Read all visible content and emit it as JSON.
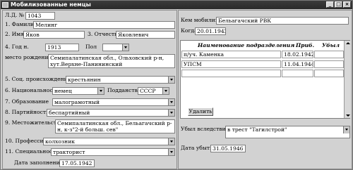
{
  "window": {
    "title": "Мобилизованные немцы"
  },
  "left": {
    "ld_label": "Л.Д. №",
    "ld_value": "1043",
    "surname_label": "1. Фамилия",
    "surname_value": "Мелинг",
    "name_label": "2. Имя",
    "name_value": "Яков",
    "patronymic_label": "3. Отчество",
    "patronymic_value": "Яковлевич",
    "birthyear_label": "4. Год н.",
    "birthyear_value": "1913",
    "sex_label": "Пол",
    "sex_value": "",
    "birthplace_label": "место рождения",
    "birthplace_value": "Семипалатинская обл., Ольховский р-н, хут.Верхне-Панининский",
    "social_label": "5. Соц. происхождение",
    "social_value": "крестьянин",
    "nationality_label": "6. Национальность",
    "nationality_value": "немец",
    "citizenship_label": "Подданство",
    "citizenship_value": "СССР",
    "education_label": "7. Образование",
    "education_value": "малограмотный",
    "party_label": "8. Партийность",
    "party_value": "беспартийный",
    "residence_label": "9. Местожительство",
    "residence_value": "Семипалатинская обл., Бельагачский р-н, к-з\"2-й больш. сев\"",
    "profession_label": "10. Профессия",
    "profession_value": "колхозник",
    "specialty_label": "11. Специальность",
    "specialty_value": "тракторист",
    "filldate_label": "Дата заполнения",
    "filldate_value": "17.05.1942"
  },
  "right": {
    "who_label": "Кем мобилизован",
    "who_value": "Бельагачский РВК",
    "when_label": "Когда",
    "when_value": "20.01.1942",
    "table": {
      "col_name": "Наименование подразделения",
      "col_arrived": "Приб.",
      "col_left": "Убыл",
      "rows": [
        {
          "name": "п/уч. Каменка",
          "arrived": "18.02.1942",
          "left": ""
        },
        {
          "name": "УПСМ",
          "arrived": "11.04.1944",
          "left": ""
        }
      ],
      "delete_label": "Удалить"
    },
    "departed_label": "Убыл вследствие",
    "departed_value": "в трест \"Тагилстрой\"",
    "departure_date_label": "Дата убытия",
    "departure_date_value": "31.05.1946"
  }
}
